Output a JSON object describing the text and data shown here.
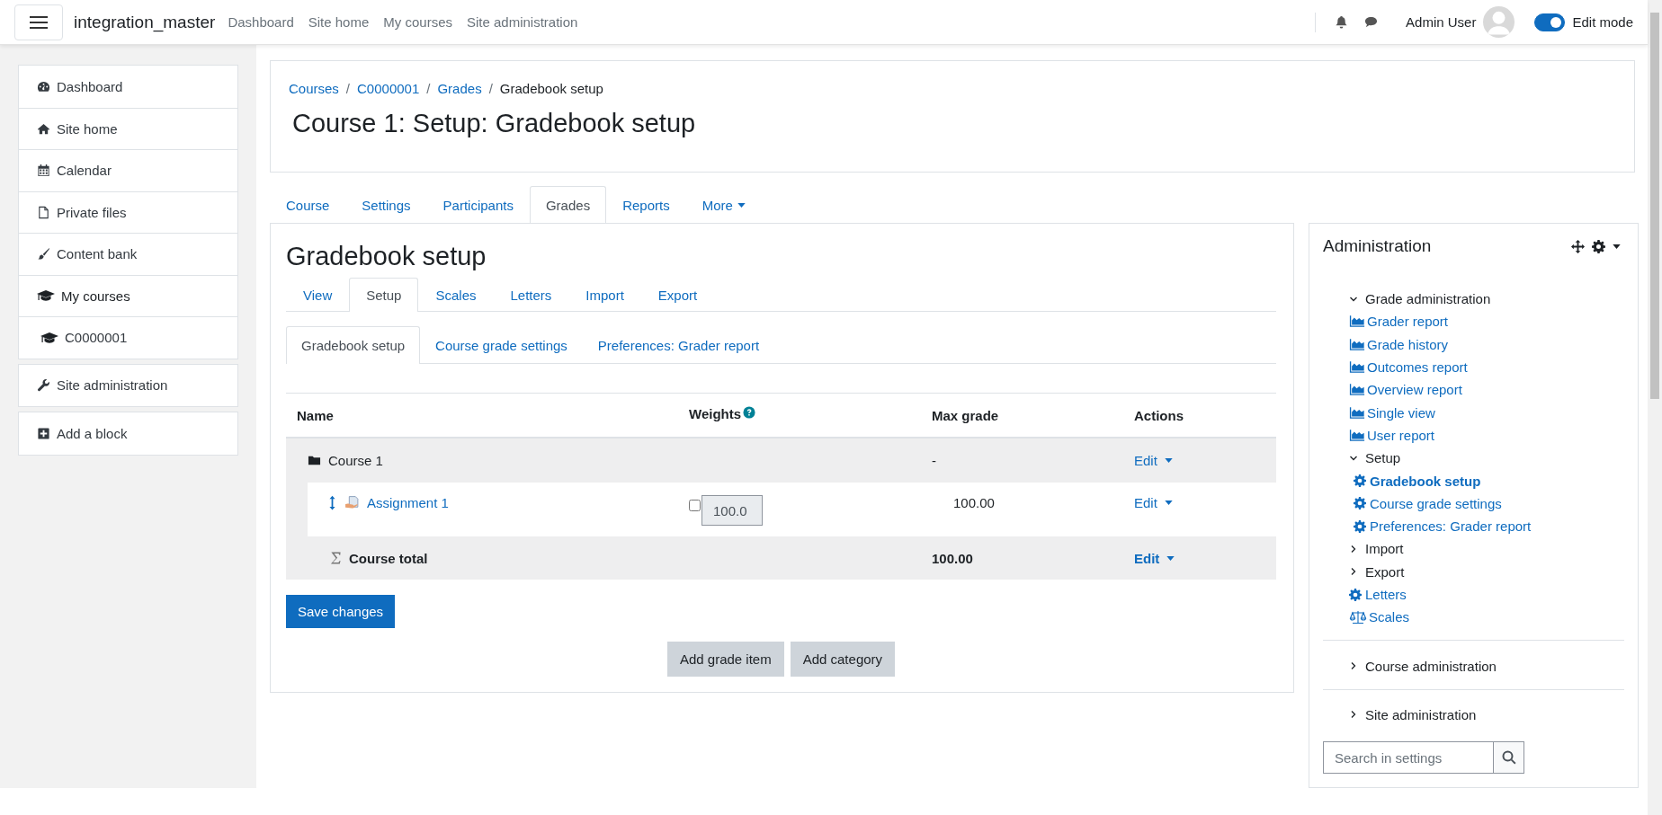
{
  "navbar": {
    "site_name": "integration_master",
    "links": [
      {
        "label": "Dashboard"
      },
      {
        "label": "Site home"
      },
      {
        "label": "My courses"
      },
      {
        "label": "Site administration"
      }
    ],
    "user_name": "Admin User",
    "edit_mode": {
      "label": "Edit mode",
      "on": true
    }
  },
  "sidebar": {
    "blocks": [
      {
        "items": [
          {
            "label": "Dashboard",
            "kind": "dashboard"
          },
          {
            "label": "Site home",
            "kind": "home"
          },
          {
            "label": "Calendar",
            "kind": "calendar"
          },
          {
            "label": "Private files",
            "kind": "file"
          },
          {
            "label": "Content bank",
            "kind": "brush"
          },
          {
            "label": "My courses",
            "kind": "course",
            "children": [
              {
                "label": "C0000001",
                "kind": "course"
              }
            ]
          }
        ]
      },
      {
        "items": [
          {
            "label": "Site administration",
            "kind": "wrench"
          }
        ]
      },
      {
        "items": [
          {
            "label": "Add a block",
            "kind": "plus"
          }
        ]
      }
    ]
  },
  "breadcrumb": [
    {
      "label": "Courses",
      "current": false
    },
    {
      "separator": "/",
      "label": "C0000001",
      "current": false
    },
    {
      "separator": "/",
      "label": "Grades",
      "current": false
    },
    {
      "separator": "/",
      "label": "Gradebook setup",
      "current": true
    }
  ],
  "page_title": "Course 1: Setup: Gradebook setup",
  "course_tabs": [
    {
      "label": "Course",
      "selected": false,
      "dropdown": false
    },
    {
      "label": "Settings",
      "selected": false,
      "dropdown": false
    },
    {
      "label": "Participants",
      "selected": false,
      "dropdown": false
    },
    {
      "label": "Grades",
      "selected": true,
      "dropdown": false
    },
    {
      "label": "Reports",
      "selected": false,
      "dropdown": false
    },
    {
      "label": "More",
      "selected": false,
      "dropdown": true
    }
  ],
  "content": {
    "heading": "Gradebook setup",
    "tabs": [
      {
        "label": "View",
        "selected": false
      },
      {
        "label": "Setup",
        "selected": true
      },
      {
        "label": "Scales",
        "selected": false
      },
      {
        "label": "Letters",
        "selected": false
      },
      {
        "label": "Import",
        "selected": false
      },
      {
        "label": "Export",
        "selected": false
      }
    ],
    "subtabs": [
      {
        "label": "Gradebook setup",
        "selected": true
      },
      {
        "label": "Course grade settings",
        "selected": false
      },
      {
        "label": "Preferences: Grader report",
        "selected": false
      }
    ],
    "table": {
      "columns": [
        {
          "label": "Name",
          "help": false
        },
        {
          "label": "Weights",
          "help": true
        },
        {
          "label": "Max grade",
          "help": false
        },
        {
          "label": "Actions",
          "help": false
        }
      ],
      "rows": [
        {
          "kind": "category",
          "name": "Course 1",
          "max_grade": "-",
          "action": "Edit"
        },
        {
          "kind": "item",
          "name": "Assignment 1",
          "weight": {
            "checked": false,
            "value": "100.0"
          },
          "max_grade": "100.00",
          "action": "Edit"
        },
        {
          "kind": "total",
          "name": "Course total",
          "max_grade": "100.00",
          "action": "Edit"
        }
      ]
    },
    "save_button": "Save changes",
    "buttons": [
      "Add grade item",
      "Add category"
    ]
  },
  "admin": {
    "title": "Administration",
    "sections": [
      {
        "label": "Grade administration",
        "kind": "branch",
        "expanded": true,
        "children": [
          {
            "label": "Grader report",
            "kind": "report",
            "selected": false
          },
          {
            "label": "Grade history",
            "kind": "report",
            "selected": false
          },
          {
            "label": "Outcomes report",
            "kind": "report",
            "selected": false
          },
          {
            "label": "Overview report",
            "kind": "report",
            "selected": false
          },
          {
            "label": "Single view",
            "kind": "report",
            "selected": false
          },
          {
            "label": "User report",
            "kind": "report",
            "selected": false
          },
          {
            "label": "Setup",
            "kind": "branch",
            "expanded": true,
            "children": [
              {
                "label": "Gradebook setup",
                "kind": "setting",
                "selected": true
              },
              {
                "label": "Course grade settings",
                "kind": "setting",
                "selected": false
              },
              {
                "label": "Preferences: Grader report",
                "kind": "setting",
                "selected": false
              }
            ]
          },
          {
            "label": "Import",
            "kind": "branch",
            "expanded": false
          },
          {
            "label": "Export",
            "kind": "branch",
            "expanded": false
          },
          {
            "label": "Letters",
            "kind": "setting",
            "selected": false
          },
          {
            "label": "Scales",
            "kind": "scale",
            "selected": false
          }
        ]
      },
      {
        "label": "Course administration",
        "kind": "branch",
        "expanded": false
      },
      {
        "label": "Site administration",
        "kind": "branch",
        "expanded": false
      }
    ],
    "search": {
      "placeholder": "Search in settings"
    }
  }
}
